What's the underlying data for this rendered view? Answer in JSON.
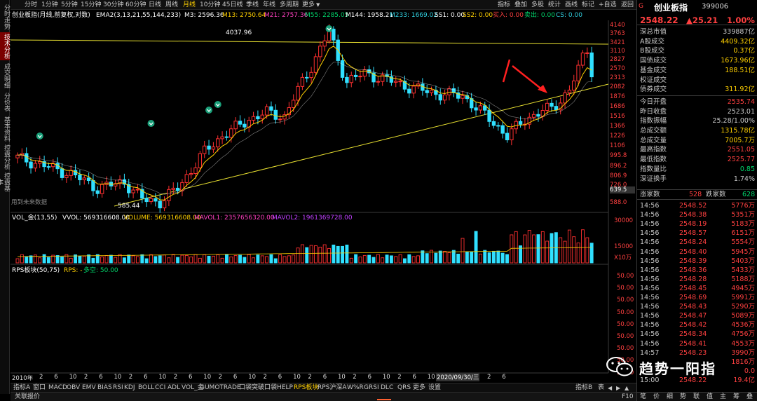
{
  "left_tabs": [
    "分时走势",
    "技术分析",
    "成交明细",
    "分价表",
    "基本资料",
    "控盘分析",
    "控盘基本"
  ],
  "periods": [
    "分时",
    "1分钟",
    "5分钟",
    "15分钟",
    "30分钟",
    "60分钟",
    "日线",
    "周线",
    "月线",
    "10分钟",
    "45日线",
    "季线",
    "年线",
    "多周期",
    "更多"
  ],
  "period_active": "月线",
  "right_tools": [
    "指标",
    "叠加",
    "多股",
    "统计",
    "画线",
    "标记",
    "+自选",
    "返回"
  ],
  "indicator_bar": {
    "title": "创业板指(月线,前复权,对数)",
    "ema": "EMA2(3,13,21,55,144,233)",
    "m3": "M3: 2596.36",
    "m13": "M13: 2750.64",
    "m21": "M21: 2757.36",
    "m55": "M55: 2285.05",
    "m144": "M144: 1958.21",
    "m233": "M233: 1669.02",
    "ss1": "SS1: 0.00",
    "ss2": "SS2: 0.00",
    "buy": "买入: 0.00",
    "sell": "卖出: 0.00",
    "cs": "CS: 0.00"
  },
  "price_axis": [
    "4140",
    "3763",
    "3421",
    "3110",
    "2827",
    "2570",
    "2313",
    "2082",
    "1876",
    "1686",
    "1516",
    "1366",
    "1226",
    "1106",
    "995.8",
    "896.2",
    "806.9",
    "726.0",
    "639.5",
    "588.0"
  ],
  "annotations": {
    "high": "4037.96",
    "low": "585.44",
    "future": "用到未来数据"
  },
  "vol_bar": {
    "title": "VOL_金(13,55)",
    "vvol": "VVOL: 569316608.00",
    "volume": "VOLUME: 569316608.00",
    "mavol1": "MAVOL1: 2357656320.00",
    "mavol2": "MAVOL2: 1961369728.00"
  },
  "vol_axis": [
    "30000",
    "15000",
    "X10万"
  ],
  "rps_bar": {
    "title": "RPS板块(50,75)",
    "rps": "RPS: -",
    "state": "多空: 50.00"
  },
  "rps_axis": [
    "50.00",
    "50.00",
    "50.00",
    "50.00",
    "50.00",
    "50.00",
    "50.00",
    "50.00",
    "50.00"
  ],
  "time_axis": {
    "year": "2010年",
    "labels": [
      "2",
      "6",
      "10",
      "2",
      "6",
      "10",
      "2",
      "6",
      "10",
      "2",
      "6",
      "10",
      "2",
      "6",
      "10",
      "2",
      "6",
      "10",
      "2",
      "6",
      "10",
      "2",
      "6",
      "10",
      "2",
      "6",
      "10",
      "2",
      "6",
      "10",
      "2",
      "6"
    ],
    "date": "2020/09/30/三"
  },
  "bottom_tabs": [
    "指标A",
    "窗口",
    "MACD",
    "OBV",
    "EMV",
    "BIAS",
    "RSI",
    "KDJ",
    "BOLL",
    "CCI",
    "ADL",
    "VOL_金",
    "GUMOTRADE",
    "口袋突破",
    "口袋HELP",
    "RPS板块",
    "RPS沪深A",
    "W%R",
    "GRSI",
    "DLC",
    "QRS",
    "更多",
    "设置"
  ],
  "bottom_right": [
    "指标B",
    "表"
  ],
  "status_bar": {
    "left": "关联报价",
    "right": "F10"
  },
  "stock": {
    "name": "创业板指",
    "code": "399006",
    "price": "2548.22",
    "change": "▲25.21",
    "pct": "1.00%",
    "g": "G"
  },
  "quote": [
    {
      "label": "深总市值",
      "value": "339887亿",
      "color": "#c8c8c8"
    },
    {
      "label": "A股成交",
      "value": "4409.32亿",
      "color": "#ffd000"
    },
    {
      "label": "B股成交",
      "value": "0.37亿",
      "color": "#ffd000"
    },
    {
      "label": "国债成交",
      "value": "1673.96亿",
      "color": "#ffd000"
    },
    {
      "label": "基金成交",
      "value": "188.51亿",
      "color": "#ffd000"
    },
    {
      "label": "权证成交",
      "value": "",
      "color": "#ffd000"
    },
    {
      "label": "债券成交",
      "value": "311.92亿",
      "color": "#ffd000"
    },
    {
      "label": "今日开盘",
      "value": "2535.74",
      "color": "#ff4040"
    },
    {
      "label": "昨日收盘",
      "value": "2523.01",
      "color": "#c8c8c8"
    },
    {
      "label": "指数振幅",
      "value": "25.28/1.00%",
      "color": "#c8c8c8"
    },
    {
      "label": "总成交额",
      "value": "1315.78亿",
      "color": "#ffd000"
    },
    {
      "label": "总成交量",
      "value": "7005.7万",
      "color": "#ffd000"
    },
    {
      "label": "最高指数",
      "value": "2551.05",
      "color": "#ff4040"
    },
    {
      "label": "最低指数",
      "value": "2525.77",
      "color": "#ff4040"
    },
    {
      "label": "指数量比",
      "value": "0.85",
      "color": "#00d46a"
    },
    {
      "label": "深证换手",
      "value": "1.74%",
      "color": "#c8c8c8"
    }
  ],
  "updown": {
    "up_label": "涨家数",
    "up": "528",
    "down_label": "跌家数",
    "down": "628"
  },
  "ticks": [
    {
      "t": "14:56",
      "p": "2548.52",
      "q": "5776万"
    },
    {
      "t": "14:56",
      "p": "2548.38",
      "q": "5351万"
    },
    {
      "t": "14:56",
      "p": "2548.19",
      "q": "5183万"
    },
    {
      "t": "14:56",
      "p": "2548.57",
      "q": "6151万"
    },
    {
      "t": "14:56",
      "p": "2548.24",
      "q": "5554万"
    },
    {
      "t": "14:56",
      "p": "2548.40",
      "q": "5945万"
    },
    {
      "t": "14:56",
      "p": "2548.39",
      "q": "5403万"
    },
    {
      "t": "14:56",
      "p": "2548.36",
      "q": "5433万"
    },
    {
      "t": "14:56",
      "p": "2548.28",
      "q": "5188万"
    },
    {
      "t": "14:56",
      "p": "2548.45",
      "q": "4945万"
    },
    {
      "t": "14:56",
      "p": "2548.69",
      "q": "5991万"
    },
    {
      "t": "14:56",
      "p": "2548.43",
      "q": "5290万"
    },
    {
      "t": "14:56",
      "p": "2548.47",
      "q": "5089万"
    },
    {
      "t": "14:56",
      "p": "2548.42",
      "q": "4536万"
    },
    {
      "t": "14:56",
      "p": "2548.34",
      "q": "4756万"
    },
    {
      "t": "14:56",
      "p": "2548.41",
      "q": "4553万"
    },
    {
      "t": "14:57",
      "p": "2548.23",
      "q": "3990万"
    },
    {
      "t": "",
      "p": "",
      "q": "1816万"
    },
    {
      "t": "",
      "p": "",
      "q": "0.0"
    },
    {
      "t": "15:00",
      "p": "2548.22",
      "q": "19.4亿"
    }
  ],
  "watermark": "趋势一阳指",
  "panel_footer": [
    "笔",
    "价",
    "细",
    "势",
    "联",
    "值",
    "主",
    "筹",
    "叠"
  ],
  "colors": {
    "up": "#ff3030",
    "down": "#30e0ff",
    "ema_fast": "#ffd000",
    "ema_mid": "#ffd000",
    "trend_line": "#e8e030",
    "arrow": "#ff2020"
  }
}
